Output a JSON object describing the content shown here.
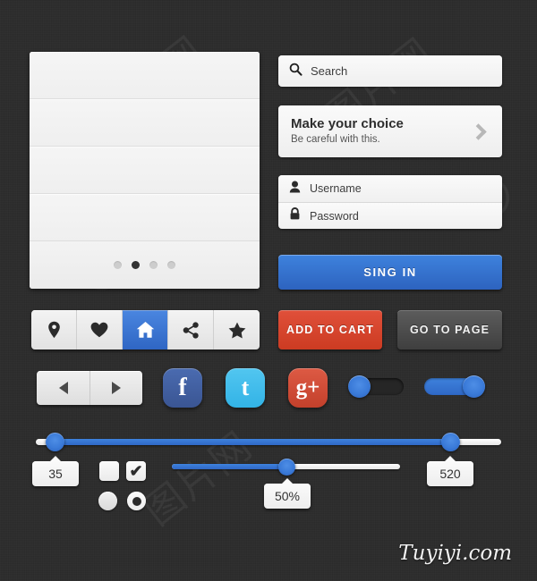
{
  "background": {
    "color": "#2c2c2c"
  },
  "watermarks": [
    {
      "name": "spiral-top-left",
      "text": "(○"
    },
    {
      "name": "cjk-text",
      "text": "图片网"
    }
  ],
  "list_panel": {
    "rows": [
      "",
      "",
      "",
      ""
    ],
    "pager": {
      "count": 4,
      "active_index": 1
    }
  },
  "search": {
    "icon": "search-icon",
    "placeholder": "Search",
    "value": ""
  },
  "choice_card": {
    "title": "Make your choice",
    "subtitle": "Be careful with this.",
    "chevron_icon": "chevron-right-icon"
  },
  "credentials": {
    "username": {
      "icon": "user-icon",
      "placeholder": "Username",
      "value": ""
    },
    "password": {
      "icon": "lock-icon",
      "placeholder": "Password",
      "value": ""
    }
  },
  "signin": {
    "label": "SING IN",
    "color": "#3e82dd"
  },
  "icon_bar": {
    "items": [
      {
        "name": "location-icon",
        "active": false
      },
      {
        "name": "heart-icon",
        "active": false
      },
      {
        "name": "home-icon",
        "active": true
      },
      {
        "name": "share-icon",
        "active": false
      },
      {
        "name": "star-icon",
        "active": false
      }
    ],
    "active_color": "#3e82dd"
  },
  "buttons": {
    "cart": {
      "label": "ADD TO CART",
      "color": "#d9452f"
    },
    "page": {
      "label": "GO TO PAGE",
      "color": "#4d4d4d"
    }
  },
  "arrow_pager": {
    "prev": {
      "icon": "triangle-left-icon"
    },
    "next": {
      "icon": "triangle-right-icon"
    }
  },
  "social": [
    {
      "name": "facebook-icon",
      "glyph": "f",
      "color": "#3a5593"
    },
    {
      "name": "twitter-icon",
      "glyph": "t",
      "color": "#32b3e6"
    },
    {
      "name": "googleplus-icon",
      "glyph": "g+",
      "color": "#c3402b"
    }
  ],
  "toggles": [
    {
      "name": "toggle-off",
      "state": "off"
    },
    {
      "name": "toggle-on",
      "state": "on"
    }
  ],
  "range_slider": {
    "min_value": "35",
    "max_value": "520",
    "min_pct": 4,
    "max_pct": 89
  },
  "single_slider": {
    "value": "50%",
    "pct": 50
  },
  "checkboxes": [
    {
      "name": "checkbox-unchecked",
      "checked": false,
      "mark": ""
    },
    {
      "name": "checkbox-checked",
      "checked": true,
      "mark": "✔"
    }
  ],
  "radios": [
    {
      "name": "radio-unselected",
      "selected": false
    },
    {
      "name": "radio-selected",
      "selected": true
    }
  ],
  "brand": {
    "text": "Tuyiyi.com"
  }
}
